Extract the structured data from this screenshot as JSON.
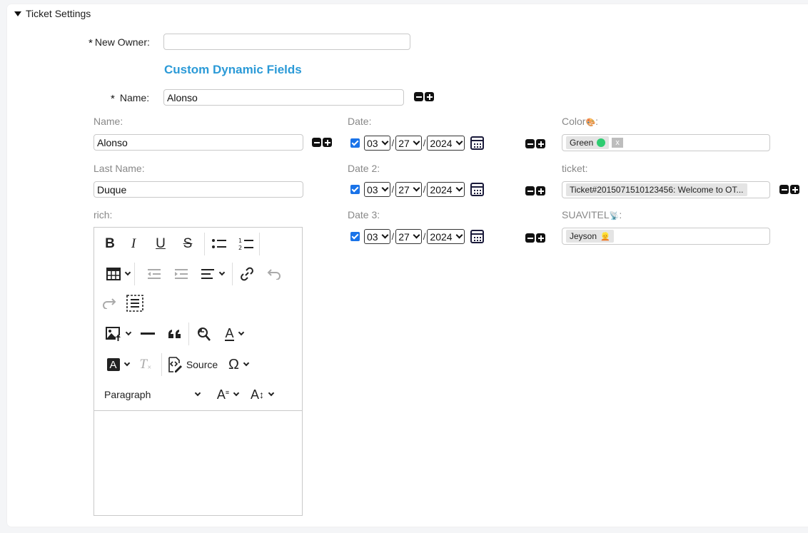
{
  "section": {
    "title": "Ticket Settings"
  },
  "owner": {
    "required_mark": "*",
    "label": "New Owner:",
    "value": ""
  },
  "dynamic": {
    "title": "Custom Dynamic Fields",
    "name_required_mark": "*",
    "name_label": "Name:",
    "name_value": "Alonso"
  },
  "fields": {
    "name": {
      "label": "Name:",
      "value": "Alonso"
    },
    "last_name": {
      "label": "Last Name:",
      "value": "Duque"
    },
    "rich": {
      "label": "rich:"
    },
    "date1": {
      "label": "Date:",
      "month": "03",
      "day": "27",
      "year": "2024",
      "checked": true
    },
    "date2": {
      "label": "Date 2:",
      "month": "03",
      "day": "27",
      "year": "2024",
      "checked": true
    },
    "date3": {
      "label": "Date 3:",
      "month": "03",
      "day": "27",
      "year": "2024",
      "checked": true
    },
    "color": {
      "label": "Color",
      "label_suffix": ":",
      "emoji": "🎨",
      "tag": "Green",
      "tag_color": "#2ecc71",
      "remove": "x"
    },
    "ticket": {
      "label": "ticket:",
      "tag": "Ticket#2015071510123456: Welcome to OT..."
    },
    "suavitel": {
      "label": "SUAVITEL",
      "label_suffix": ":",
      "emoji": "📡",
      "tag": "Jeyson",
      "tag_emoji": "👱"
    }
  },
  "editor": {
    "bold": "B",
    "italic": "I",
    "underline": "U",
    "strike": "S",
    "source_label": "Source",
    "omega": "Ω",
    "paragraph": "Paragraph",
    "font_icon": "A",
    "text_color_icon": "A",
    "bg_color_icon": "A",
    "clear_icon": "T",
    "font_size_icon": "A"
  },
  "colors": {
    "accent": "#2b9ad7",
    "checkbox": "#1a73e8"
  }
}
